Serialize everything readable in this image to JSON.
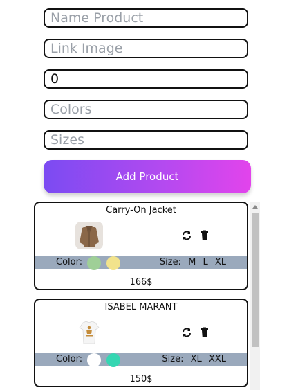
{
  "form": {
    "name_placeholder": "Name Product",
    "image_placeholder": "Link Image",
    "price_value": "0",
    "colors_placeholder": "Colors",
    "sizes_placeholder": "Sizes",
    "submit_label": "Add Product"
  },
  "products": [
    {
      "name": "Carry-On Jacket",
      "color_label": "Color:",
      "colors": [
        "#9fcf97",
        "#f2e38c"
      ],
      "size_label": "Size:",
      "sizes": [
        "M",
        "L",
        "XL"
      ],
      "price": "166$"
    },
    {
      "name": "ISABEL MARANT",
      "color_label": "Color:",
      "colors": [
        "#ffffff",
        "#35d6b2"
      ],
      "size_label": "Size:",
      "sizes": [
        "XL",
        "XXL"
      ],
      "price": "150$"
    }
  ],
  "icons": {
    "refresh": "refresh-icon",
    "delete": "trash-icon"
  }
}
